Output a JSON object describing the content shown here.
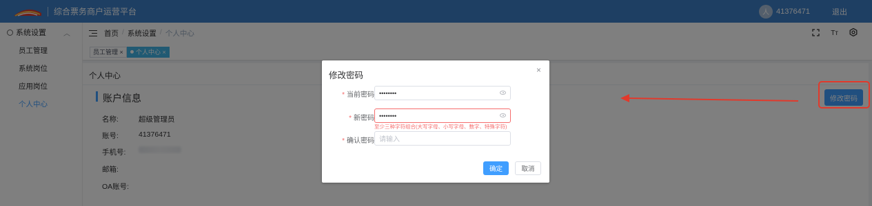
{
  "header": {
    "app_title": "综合票务商户运营平台",
    "avatar_text": "人",
    "username": "41376471",
    "logout_label": "退出"
  },
  "sidebar": {
    "group_label": "系统设置",
    "items": [
      {
        "label": "员工管理",
        "active": false
      },
      {
        "label": "系统岗位",
        "active": false
      },
      {
        "label": "应用岗位",
        "active": false
      },
      {
        "label": "个人中心",
        "active": true
      }
    ]
  },
  "breadcrumb": [
    "首页",
    "系统设置",
    "个人中心"
  ],
  "tools": {
    "fullscreen_icon": "fullscreen-icon",
    "font_size_label": "Tт",
    "settings_icon": "settings-icon"
  },
  "tags": [
    {
      "label": "员工管理 ×",
      "active": false
    },
    {
      "label": "个人中心 ×",
      "active": true
    }
  ],
  "page": {
    "card_title": "个人中心",
    "section_title": "账户信息",
    "fields": [
      {
        "label": "名称:",
        "value": "超级管理员"
      },
      {
        "label": "账号:",
        "value": "41376471"
      },
      {
        "label": "手机号:",
        "value": ""
      },
      {
        "label": "邮箱:",
        "value": ""
      },
      {
        "label": "OA账号:",
        "value": ""
      }
    ],
    "change_password_label": "修改密码"
  },
  "dialog": {
    "title": "修改密码",
    "close_label": "×",
    "fields": [
      {
        "label": "当前密码",
        "value": "••••••••",
        "placeholder": ""
      },
      {
        "label": "新密码",
        "value": "••••••••",
        "placeholder": ""
      },
      {
        "label": "确认密码",
        "value": "",
        "placeholder": "请输入"
      }
    ],
    "required_mark": "*",
    "error_message": "至少三种字符组合(大写字母、小写字母、数字、特殊字符)",
    "ok_label": "确定",
    "cancel_label": "取消"
  },
  "colors": {
    "header": "#3c7ec6",
    "primary": "#409eff",
    "active_tag": "#42b4e6",
    "error": "#f56c6c",
    "annotation": "#e2392b"
  }
}
